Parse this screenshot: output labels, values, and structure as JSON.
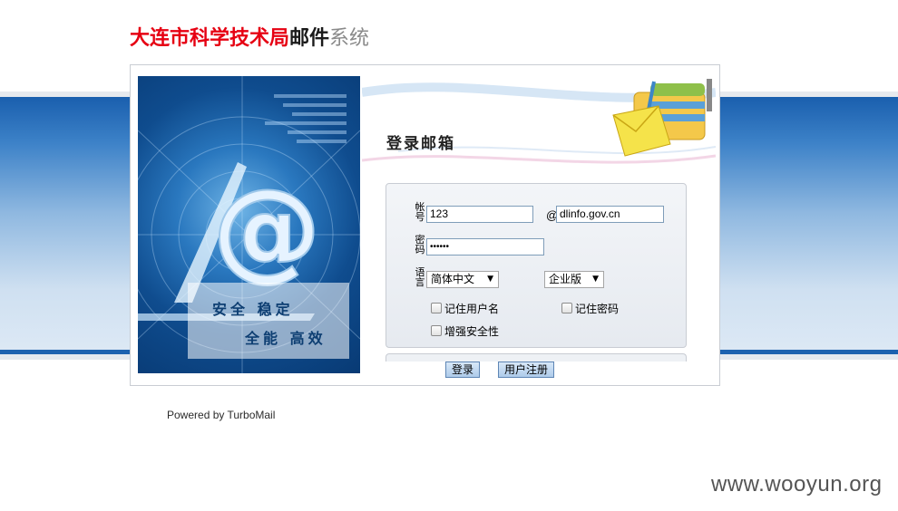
{
  "header": {
    "title_red": "大连市科学技术局",
    "title_dark": "邮件",
    "title_gray": "系统"
  },
  "art": {
    "slogan_line1": "安全  稳定",
    "slogan_line2": "全能  高效"
  },
  "login": {
    "heading": "登录邮箱",
    "account_label": "帐号",
    "account_value": "123",
    "at_sign": "@",
    "domain_value": "dlinfo.gov.cn",
    "password_label": "密码",
    "password_value": "••••••",
    "language_label": "语言",
    "language_selected": "简体中文",
    "edition_selected": "企业版",
    "remember_username": "记住用户名",
    "remember_password": "记住密码",
    "enhanced_security": "增强安全性",
    "login_button": "登录",
    "register_button": "用户注册"
  },
  "footer": {
    "powered_by": "Powered by TurboMail"
  },
  "watermark": "www.wooyun.org",
  "colors": {
    "title_red": "#e60012",
    "band_blue": "#1a5fae"
  }
}
